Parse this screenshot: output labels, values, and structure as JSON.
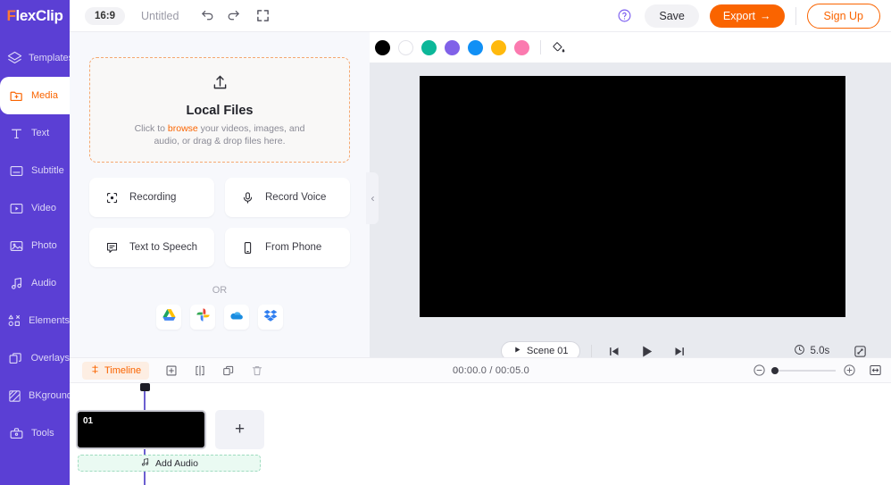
{
  "header": {
    "logo": "FlexClip",
    "logo_first_letter": "F",
    "logo_rest": "lexClip",
    "aspect_ratio": "16:9",
    "project_title": "Untitled",
    "undo_icon": "undo-icon",
    "redo_icon": "redo-icon",
    "fullscreen_icon": "fullscreen-icon",
    "help_icon": "help-circle-icon",
    "save_label": "Save",
    "export_label": "Export",
    "export_arrow": "→",
    "signup_label": "Sign Up"
  },
  "sidebar": {
    "items": [
      {
        "label": "Templates",
        "icon": "layers-icon",
        "active": false
      },
      {
        "label": "Media",
        "icon": "media-folder-icon",
        "active": true
      },
      {
        "label": "Text",
        "icon": "text-icon",
        "active": false
      },
      {
        "label": "Subtitle",
        "icon": "subtitle-icon",
        "active": false
      },
      {
        "label": "Video",
        "icon": "video-icon",
        "active": false
      },
      {
        "label": "Photo",
        "icon": "photo-icon",
        "active": false
      },
      {
        "label": "Audio",
        "icon": "audio-note-icon",
        "active": false
      },
      {
        "label": "Elements",
        "icon": "elements-shapes-icon",
        "active": false
      },
      {
        "label": "Overlays",
        "icon": "overlays-icon",
        "active": false
      },
      {
        "label": "BKground",
        "icon": "background-icon",
        "active": false
      },
      {
        "label": "Tools",
        "icon": "toolbox-icon",
        "active": false
      }
    ]
  },
  "media_panel": {
    "dropzone": {
      "upload_icon": "upload-arrow-icon",
      "title": "Local Files",
      "sub_prefix": "Click to ",
      "sub_link": "browse",
      "sub_line1_rest": " your videos, images, and",
      "sub_line2": "audio, or drag & drop files here."
    },
    "actions": [
      {
        "label": "Recording",
        "icon": "screen-record-icon"
      },
      {
        "label": "Record Voice",
        "icon": "microphone-icon"
      },
      {
        "label": "Text to Speech",
        "icon": "speech-bubble-icon"
      },
      {
        "label": "From Phone",
        "icon": "phone-icon"
      }
    ],
    "or_label": "OR",
    "cloud_services": [
      {
        "name": "google-drive-icon"
      },
      {
        "name": "google-photos-icon"
      },
      {
        "name": "onedrive-icon"
      },
      {
        "name": "dropbox-icon"
      }
    ],
    "collapse_icon": "chevron-left-icon"
  },
  "canvas": {
    "swatches": [
      {
        "name": "black",
        "color": "#000000"
      },
      {
        "name": "white",
        "color": "#ffffff"
      },
      {
        "name": "teal",
        "color": "#0cb799"
      },
      {
        "name": "purple",
        "color": "#8061e8"
      },
      {
        "name": "blue",
        "color": "#1190f5"
      },
      {
        "name": "amber",
        "color": "#ffb90d"
      },
      {
        "name": "pink",
        "color": "#fb7aaf"
      }
    ],
    "bucket_icon": "paint-bucket-icon",
    "stage_color": "#000000"
  },
  "player": {
    "scene_label": "Scene  01",
    "scene_play_icon": "play-small-icon",
    "prev_icon": "skip-previous-icon",
    "play_icon": "play-icon",
    "next_icon": "skip-next-icon",
    "clock_icon": "clock-icon",
    "duration": "5.0s",
    "expand_icon": "expand-icon"
  },
  "timeline": {
    "chip_label": "Timeline",
    "chip_icon": "timeline-icon",
    "tools": [
      {
        "name": "add-icon"
      },
      {
        "name": "split-icon"
      },
      {
        "name": "duplicate-icon"
      },
      {
        "name": "delete-icon"
      }
    ],
    "time_readout": "00:00.0 / 00:05.0",
    "zoom_out_icon": "zoom-out-icon",
    "zoom_in_icon": "zoom-in-icon",
    "fit_icon": "fit-to-screen-icon",
    "zoom_value": 0
  },
  "tracks": {
    "scene_number": "01",
    "add_scene_label": "+",
    "audio_label": "Add Audio",
    "audio_icon": "music-note-icon"
  }
}
